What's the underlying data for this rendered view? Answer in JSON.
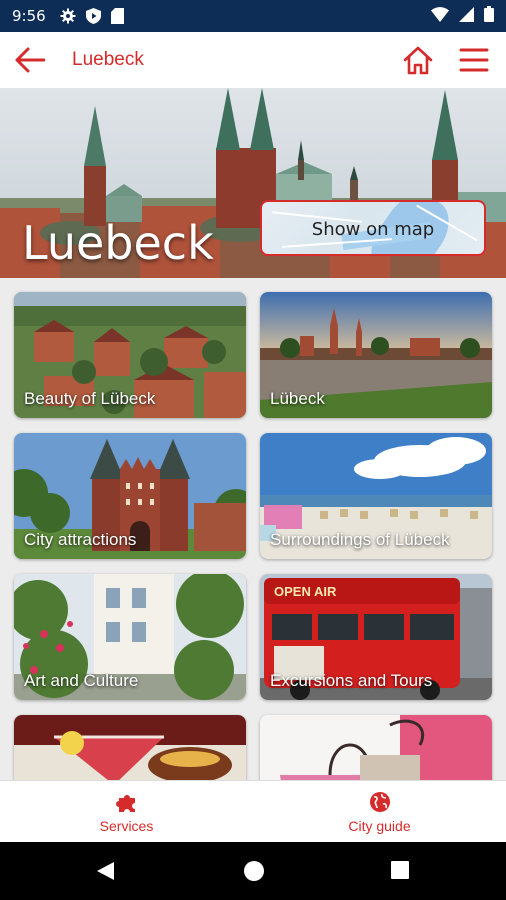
{
  "status_bar": {
    "time": "9:56",
    "icons": [
      "gear-icon",
      "shield-play-icon",
      "sd-card-icon"
    ],
    "right_icons": [
      "wifi-icon",
      "signal-icon",
      "battery-icon"
    ]
  },
  "app_bar": {
    "title": "Luebeck",
    "back_icon": "arrow-left-icon",
    "home_icon": "home-icon",
    "menu_icon": "hamburger-icon"
  },
  "hero": {
    "title": "Luebeck",
    "map_button": "Show on map"
  },
  "tiles": [
    {
      "label": "Beauty of Lübeck"
    },
    {
      "label": "Lübeck"
    },
    {
      "label": "City attractions"
    },
    {
      "label": "Surroundings of Lübeck"
    },
    {
      "label": "Art and Culture"
    },
    {
      "label": "Excursions and Tours"
    },
    {
      "label": ""
    },
    {
      "label": ""
    }
  ],
  "bottom_nav": [
    {
      "label": "Services",
      "icon": "puzzle-icon"
    },
    {
      "label": "City guide",
      "icon": "globe-icon"
    }
  ],
  "colors": {
    "accent": "#d62b2b",
    "status_bar": "#0d2c56"
  }
}
